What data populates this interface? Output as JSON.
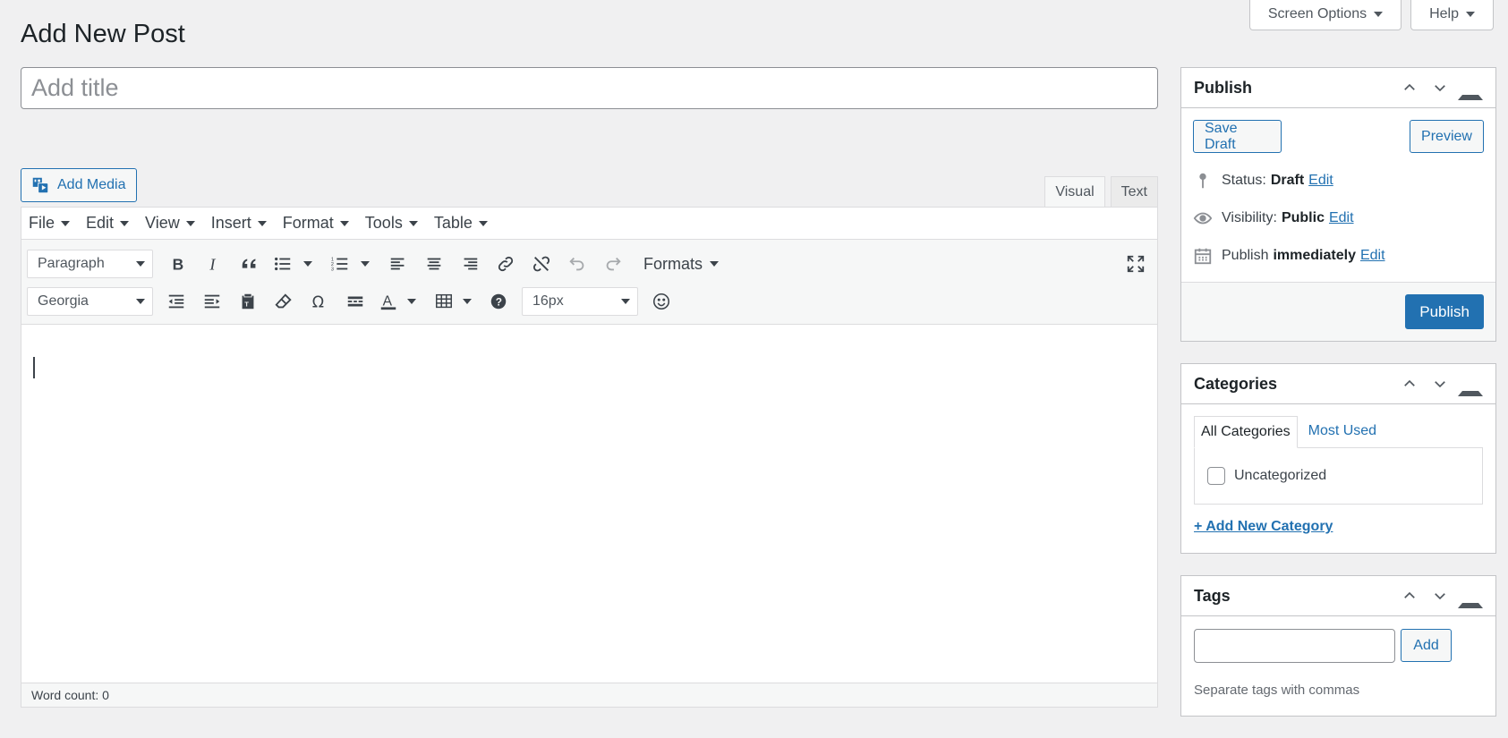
{
  "screen_meta": {
    "screen_options": "Screen Options",
    "help": "Help"
  },
  "page_title": "Add New Post",
  "title_input": {
    "placeholder": "Add title",
    "value": ""
  },
  "add_media": "Add Media",
  "editor_tabs": {
    "visual": "Visual",
    "text": "Text"
  },
  "menubar": [
    "File",
    "Edit",
    "View",
    "Insert",
    "Format",
    "Tools",
    "Table"
  ],
  "toolbar": {
    "block_format": "Paragraph",
    "formats_label": "Formats",
    "font_family": "Georgia",
    "font_size": "16px"
  },
  "status": {
    "word_count": "Word count: 0"
  },
  "publish": {
    "title": "Publish",
    "save_draft": "Save Draft",
    "preview": "Preview",
    "status_label": "Status:",
    "status_value": "Draft",
    "visibility_label": "Visibility:",
    "visibility_value": "Public",
    "schedule_label": "Publish",
    "schedule_value": "immediately",
    "edit": "Edit",
    "publish_button": "Publish"
  },
  "categories": {
    "title": "Categories",
    "tab_all": "All Categories",
    "tab_most_used": "Most Used",
    "items": [
      "Uncategorized"
    ],
    "add_new": "+ Add New Category"
  },
  "tags": {
    "title": "Tags",
    "add_button": "Add",
    "help": "Separate tags with commas"
  },
  "colors": {
    "accent": "#2271b1",
    "background": "#f0f0f1"
  }
}
